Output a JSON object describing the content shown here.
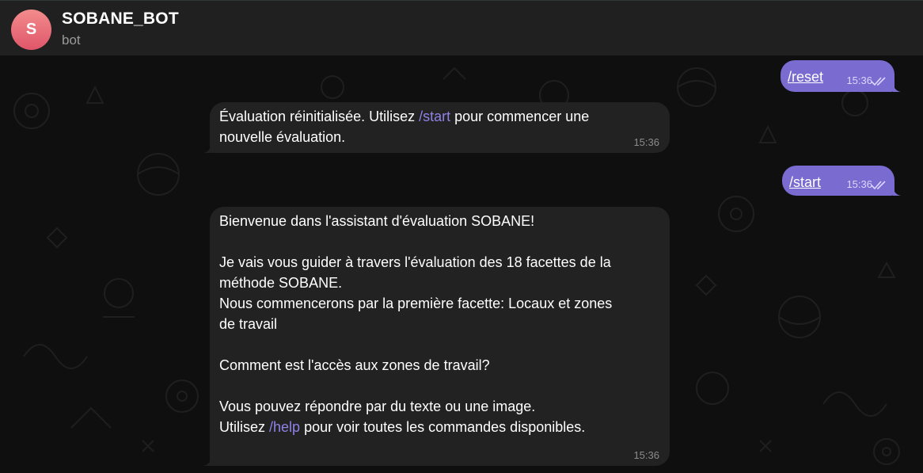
{
  "header": {
    "avatar_letter": "S",
    "title": "SOBANE_BOT",
    "status": "bot"
  },
  "messages": [
    {
      "direction": "out",
      "text": "/reset",
      "time": "15:36",
      "status_icon": "double-check-icon"
    },
    {
      "direction": "in",
      "line1_before": "Évaluation réinitialisée. Utilisez ",
      "line1_link": "/start",
      "line1_after": " pour commencer une",
      "line2": "nouvelle évaluation.",
      "time": "15:36"
    },
    {
      "direction": "out",
      "text": "/start",
      "time": "15:36",
      "status_icon": "double-check-icon"
    },
    {
      "direction": "in",
      "p1": "Bienvenue dans l'assistant d'évaluation SOBANE!",
      "p2_l1": "Je vais vous guider à travers l'évaluation des 18 facettes de la",
      "p2_l2": "méthode SOBANE.",
      "p2_l3": "Nous commencerons par la première facette: Locaux et zones",
      "p2_l4": "de travail",
      "p3": "Comment est l'accès aux zones de travail?",
      "p4_l1": "Vous pouvez répondre par du texte ou une image.",
      "p4_l2_before": "Utilisez ",
      "p4_l2_link": "/help",
      "p4_l2_after": " pour voir toutes les commandes disponibles.",
      "time": "15:36"
    }
  ],
  "colors": {
    "outgoing_bubble": "#7a6bd0",
    "incoming_bubble": "#222222",
    "link": "#8e82e6",
    "header_bg": "#202020",
    "background": "#0f0f0f"
  }
}
